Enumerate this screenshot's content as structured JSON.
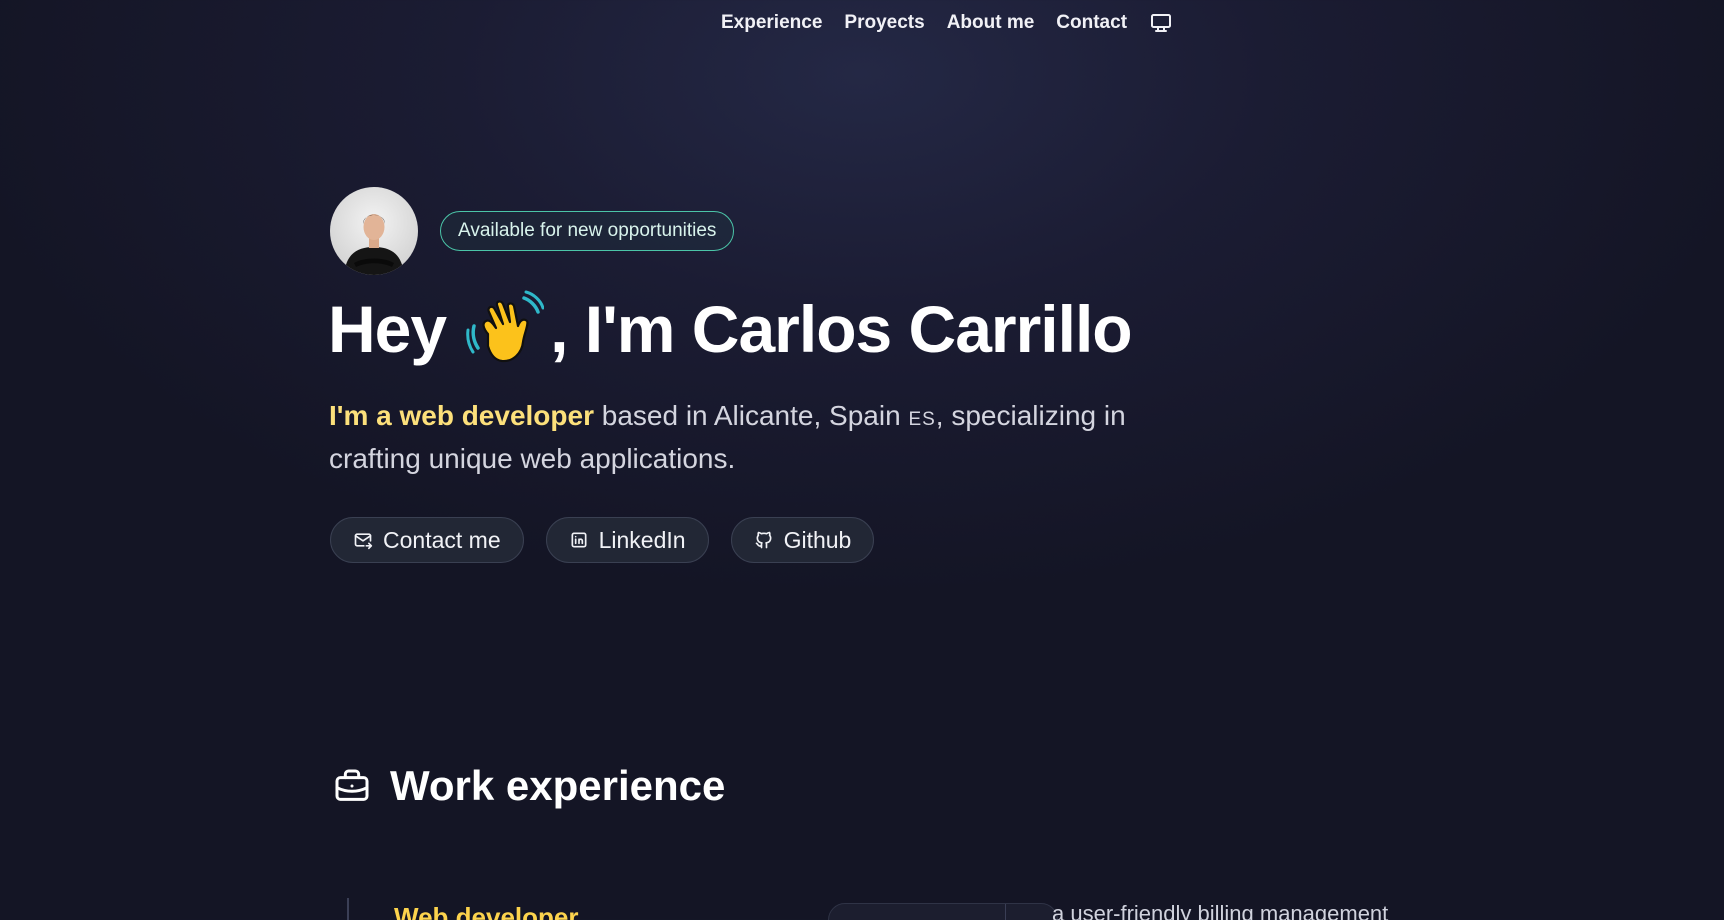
{
  "nav": {
    "items": [
      "Experience",
      "Proyects",
      "About me",
      "Contact"
    ],
    "theme_icon": "monitor-icon"
  },
  "hero": {
    "badge": "Available for new opportunities",
    "title_before": "Hey",
    "title_emoji": "waving-hand-icon",
    "title_after": ", I'm Carlos Carrillo",
    "intro_highlight": "I'm a web developer",
    "intro_part1": " based in Alicante, Spain ",
    "intro_flag": "ES",
    "intro_part2": ", specializing in crafting unique web applications.",
    "buttons": [
      {
        "label": "Contact me",
        "icon": "mail-icon"
      },
      {
        "label": "LinkedIn",
        "icon": "linkedin-icon"
      },
      {
        "label": "Github",
        "icon": "github-icon"
      }
    ]
  },
  "experience": {
    "title": "Work experience",
    "icon": "briefcase-icon",
    "first_job_title": "Web developer",
    "first_job_desc": "a user-friendly billing management"
  },
  "colors": {
    "accent": "#fcd34d",
    "badge_border": "#4bc5a8",
    "background": "#1b1c33"
  }
}
